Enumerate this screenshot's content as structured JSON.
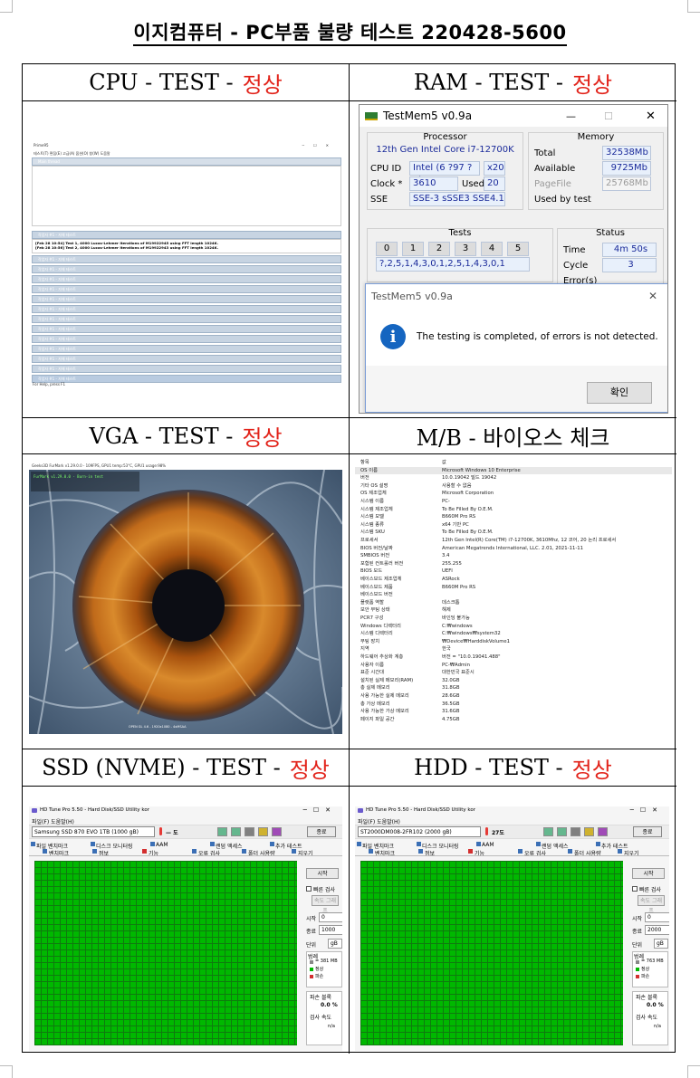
{
  "document": {
    "title": "이지컴퓨터 - PC부품 불량 테스트 220428-5600"
  },
  "sections": {
    "cpu": {
      "name": "CPU - TEST -",
      "result": "정상"
    },
    "ram": {
      "name": "RAM - TEST -",
      "result": "정상"
    },
    "vga": {
      "name": "VGA - TEST -",
      "result": "정상"
    },
    "mb": {
      "name": "M/B - 바이오스 체크",
      "result": ""
    },
    "ssd": {
      "name": "SSD (NVME) - TEST -",
      "result": "정상"
    },
    "hdd": {
      "name": "HDD - TEST -",
      "result": "정상"
    }
  },
  "prime95": {
    "title": "Prime95",
    "menu": "테스트(T)  편집(E)  고급(A)  옵션(O)  창(W)  도움말",
    "main_thread": "Main thread",
    "worker": "작업자 #1 - 자체 테스트",
    "log1": "[Feb 28 10:54] Test 1, 4000 Lucas-Lehmer iterations of M19922945 using FFT length 1024K.",
    "log2": "[Feb 28 10:56] Test 2, 4000 Lucas-Lehmer iterations of M19922943 using FFT length 1024K.",
    "status": "For Help, press F1"
  },
  "testmem": {
    "title": "TestMem5 v0.9a",
    "processor_label": "Processor",
    "cpu_name": "12th Gen Intel Core i7-12700K",
    "cpu_id_label": "CPU ID",
    "cpu_id": "Intel  (6 ?97 ?2)",
    "threads": "x20",
    "clock_label": "Clock *",
    "clock": "3610 MHz",
    "used_label": "Used",
    "used": "20",
    "sse_label": "SSE",
    "sse": "SSE-3 sSSE3 SSE4.1",
    "memory_label": "Memory",
    "total_label": "Total",
    "total": "32538Mb",
    "available_label": "Available",
    "available": "9725Mb",
    "pagefile_label": "PageFile",
    "pagefile": "25768Mb",
    "used_by_test_label": "Used by test",
    "tests_label": "Tests",
    "test_numbers": [
      "0",
      "1",
      "2",
      "3",
      "4",
      "5"
    ],
    "sequence": "?,2,5,1,4,3,0,1,2,5,1,4,3,0,1",
    "status_label": "Status",
    "time_label": "Time",
    "time": "4m 50s",
    "cycle_label": "Cycle",
    "cycle": "3",
    "errors_label": "Error(s)",
    "dialog_title": "TestMem5 v0.9a",
    "dialog_message": "The testing is completed, of errors is not detected.",
    "ok_button": "확인",
    "win_min": "—",
    "win_max": "☐",
    "win_close": "✕"
  },
  "furmark": {
    "title": "Geeks3D FurMark v1.29.0.0 - 109FPS, GPU1 temp:53°C, GPU1 usage:98%",
    "bottom": "OPEN GL 4.6 - 1920x1080 - 4xMSAA"
  },
  "sysinfo": {
    "header": [
      "항목",
      "값"
    ],
    "rows": [
      [
        "OS 이름",
        "Microsoft Windows 10 Enterprise"
      ],
      [
        "버전",
        "10.0.19042 빌드 19042"
      ],
      [
        "기타 OS 설명",
        "사용할 수 없음"
      ],
      [
        "OS 제조업체",
        "Microsoft Corporation"
      ],
      [
        "시스템 이름",
        "PC-"
      ],
      [
        "시스템 제조업체",
        "To Be Filled By O.E.M."
      ],
      [
        "시스템 모델",
        "B660M Pro RS"
      ],
      [
        "시스템 종류",
        "x64 기반 PC"
      ],
      [
        "시스템 SKU",
        "To Be Filled By O.E.M."
      ],
      [
        "프로세서",
        "12th Gen Intel(R) Core(TM) i7-12700K, 3610Mhz, 12 코어, 20 논리 프로세서"
      ],
      [
        "BIOS 버전/날짜",
        "American Megatrends International, LLC. 2.01, 2021-11-11"
      ],
      [
        "SMBIOS 버전",
        "3.4"
      ],
      [
        "포함된 컨트롤러 버전",
        "255.255"
      ],
      [
        "BIOS 모드",
        "UEFI"
      ],
      [
        "베이스보드 제조업체",
        "ASRock"
      ],
      [
        "베이스보드 제품",
        "B660M Pro RS"
      ],
      [
        "베이스보드 버전",
        ""
      ],
      [
        "플랫폼 역할",
        "데스크톱"
      ],
      [
        "보안 부팅 상태",
        "해제"
      ],
      [
        "PCR7 구성",
        "바인딩 불가능"
      ],
      [
        "Windows 디렉터리",
        "C:₩windows"
      ],
      [
        "시스템 디렉터리",
        "C:₩windows₩system32"
      ],
      [
        "부팅 장치",
        "₩Device₩HarddiskVolume1"
      ],
      [
        "지역",
        "한국"
      ],
      [
        "하드웨어 추상화 계층",
        "버전 = \"10.0.19041.488\""
      ],
      [
        "사용자 이름",
        "PC-₩Admin"
      ],
      [
        "표준 시간대",
        "대한민국 표준시"
      ],
      [
        "설치된 실제 메모리(RAM)",
        "32.0GB"
      ],
      [
        "총 실제 메모리",
        "31.8GB"
      ],
      [
        "사용 가능한 실제 메모리",
        "28.6GB"
      ],
      [
        "총 가상 메모리",
        "36.5GB"
      ],
      [
        "사용 가능한 가상 메모리",
        "31.6GB"
      ],
      [
        "페이지 파일 공간",
        "4.75GB"
      ]
    ]
  },
  "hdtune_ssd": {
    "title": "HD Tune Pro 5.50 - Hard Disk/SSD Utility kor",
    "menu": "파일(F)   도움말(H)",
    "drive": "Samsung SSD 870 EVO 1TB (1000 gB)",
    "temp": "— 도",
    "exit": "종료",
    "tabs_row1": [
      "파일 벤치마크",
      "디스크 모니터링",
      "AAM",
      "랜덤 액세스",
      "추가 테스트"
    ],
    "tabs_row2": [
      "벤치마크",
      "정보",
      "기능",
      "오류 검사",
      "폴더 사용량",
      "지우기"
    ],
    "start": "시작",
    "quick": "빠른 검사",
    "speed_map": "속도 그래프",
    "start_label": "시작",
    "start_val": "0",
    "end_label": "종료",
    "end_val": "1000",
    "unit_label": "단위",
    "unit_val": "gB",
    "legend_label": "범례",
    "block": "= 381 MB",
    "normal": "정상",
    "damaged": "파손",
    "damaged_blocks": "파손 블록",
    "damaged_pct": "0.0 %",
    "scan_speed": "검사 속도",
    "scan_val": "n/a"
  },
  "hdtune_hdd": {
    "title": "HD Tune Pro 5.50 - Hard Disk/SSD Utility kor",
    "menu": "파일(F)   도움말(H)",
    "drive": "ST2000DM008-2FR102 (2000 gB)",
    "temp": "27도",
    "exit": "종료",
    "tabs_row1": [
      "파일 벤치마크",
      "디스크 모니터링",
      "AAM",
      "랜덤 액세스",
      "추가 테스트"
    ],
    "tabs_row2": [
      "벤치마크",
      "정보",
      "기능",
      "오류 검사",
      "폴더 사용량",
      "지우기"
    ],
    "start": "시작",
    "quick": "빠른 검사",
    "speed_map": "속도 그래프",
    "start_label": "시작",
    "start_val": "0",
    "end_label": "종료",
    "end_val": "2000",
    "unit_label": "단위",
    "unit_val": "gB",
    "legend_label": "범례",
    "block": "= 763 MB",
    "normal": "정상",
    "damaged": "파손",
    "damaged_blocks": "파손 블록",
    "damaged_pct": "0.0 %",
    "scan_speed": "검사 속도",
    "scan_val": "n/a"
  },
  "colors": {
    "ok_red": "#e2231a",
    "green_block": "#00b800",
    "info_blue": "#1565c0"
  }
}
